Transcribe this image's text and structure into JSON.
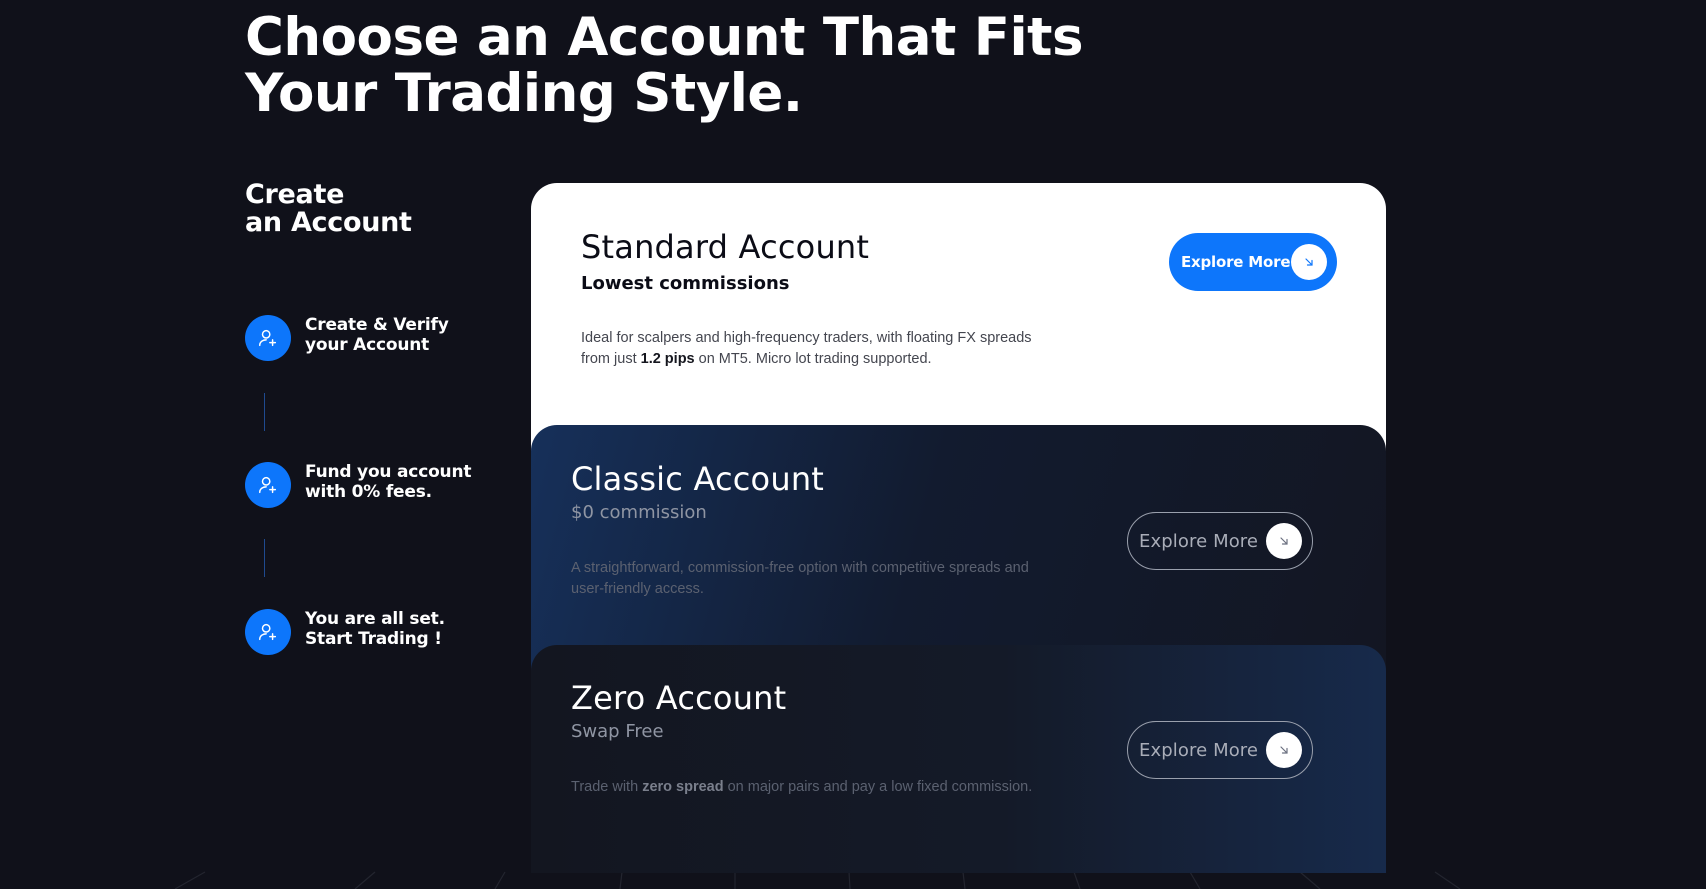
{
  "hero": {
    "title_line1": "Choose an Account That Fits",
    "title_line2": "Your Trading Style."
  },
  "steps": {
    "title_line1": "Create",
    "title_line2": "an Account",
    "items": [
      {
        "line1": "Create & Verify",
        "line2": "your Account",
        "icon": "add-user-icon"
      },
      {
        "line1": "Fund you account",
        "line2": "with 0% fees.",
        "icon": "add-user-icon"
      },
      {
        "line1": "You are all set.",
        "line2": "Start Trading !",
        "icon": "add-user-icon"
      }
    ]
  },
  "accounts": [
    {
      "title": "Standard Account",
      "subtitle": "Lowest commissions",
      "desc_line1": "Ideal for scalpers and high-frequency traders, with floating FX spreads",
      "desc_pre": "from just ",
      "desc_bold": "1.2 pips",
      "desc_post": " on MT5. Micro lot trading supported.",
      "button_label": "Explore More"
    },
    {
      "title": "Classic Account",
      "subtitle": "$0 commission",
      "desc_line1": "A straightforward, commission-free option with competitive spreads and",
      "desc_line2": "user-friendly access.",
      "button_label": "Explore More"
    },
    {
      "title": "Zero Account",
      "subtitle": "Swap Free",
      "desc_pre": "Trade with ",
      "desc_bold": "zero spread",
      "desc_post": " on major pairs and pay a low fixed commission.",
      "button_label": "Explore More"
    }
  ],
  "colors": {
    "background": "#10111a",
    "accent": "#0d76fb",
    "standard_card": "#ffffff"
  }
}
